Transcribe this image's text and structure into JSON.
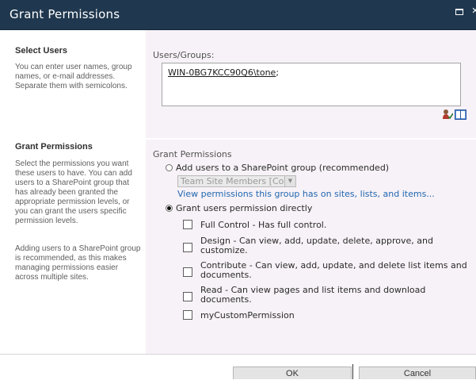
{
  "dialog": {
    "title": "Grant Permissions"
  },
  "select_users": {
    "heading": "Select Users",
    "description": "You can enter user names, group names, or e-mail addresses. Separate them with semicolons.",
    "field_label": "Users/Groups:",
    "entries": [
      {
        "text": "WIN-0BG7KCC90Q6\\tone",
        "separator": ";"
      }
    ],
    "icons": [
      "check-names-icon",
      "address-book-icon"
    ]
  },
  "grant_permissions": {
    "heading": "Grant Permissions",
    "description_1": "Select the permissions you want these users to have. You can add users to a SharePoint group that has already been granted the appropriate permission levels, or you can grant the users specific permission levels.",
    "description_2": "Adding users to a SharePoint group is recommended, as this makes managing permissions easier across multiple sites.",
    "field_label": "Grant Permissions",
    "option_group": {
      "label": "Add users to a SharePoint group (recommended)",
      "selected": false,
      "group_value": "Team Site Members [Contribute]",
      "view_link": "View permissions this group has on sites, lists, and items..."
    },
    "option_direct": {
      "label": "Grant users permission directly",
      "selected": true
    },
    "permissions": [
      {
        "label": "Full Control - Has full control.",
        "checked": false
      },
      {
        "label": "Design - Can view, add, update, delete, approve, and customize.",
        "checked": false
      },
      {
        "label": "Contribute - Can view, add, update, and delete list items and documents.",
        "checked": false
      },
      {
        "label": "Read - Can view pages and list items and download documents.",
        "checked": false
      },
      {
        "label": "myCustomPermission",
        "checked": false
      }
    ]
  },
  "footer": {
    "ok_label": "OK",
    "cancel_label": "Cancel"
  },
  "colors": {
    "titlebar": "#20384f",
    "section_bg": "#f7f2f7",
    "link": "#2167b0"
  }
}
